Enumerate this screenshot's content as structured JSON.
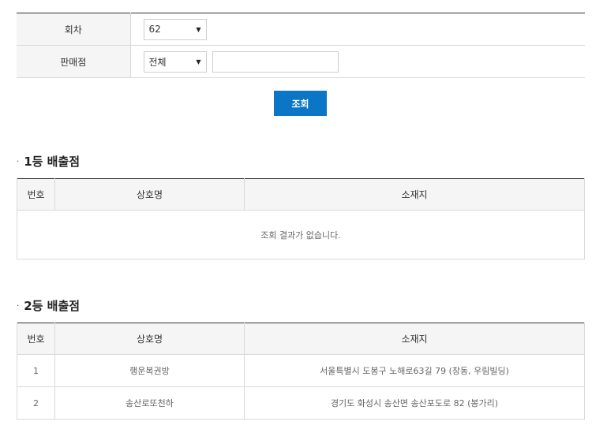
{
  "search": {
    "round_label": "회차",
    "round_value": "62",
    "store_label": "판매점",
    "store_value": "전체",
    "store_input_value": "",
    "submit_label": "조회"
  },
  "first_prize": {
    "title": "1등 배출점",
    "columns": [
      "번호",
      "상호명",
      "소재지"
    ],
    "empty_message": "조회 결과가 없습니다."
  },
  "second_prize": {
    "title": "2등 배출점",
    "columns": [
      "번호",
      "상호명",
      "소재지"
    ],
    "rows": [
      {
        "no": "1",
        "name": "행운복권방",
        "address": "서울특별시 도봉구 노해로63길 79 (창동, 우림빌딩)"
      },
      {
        "no": "2",
        "name": "송산로또천하",
        "address": "경기도 화성시 송산면 송산포도로 82 (봉가리)"
      }
    ]
  }
}
